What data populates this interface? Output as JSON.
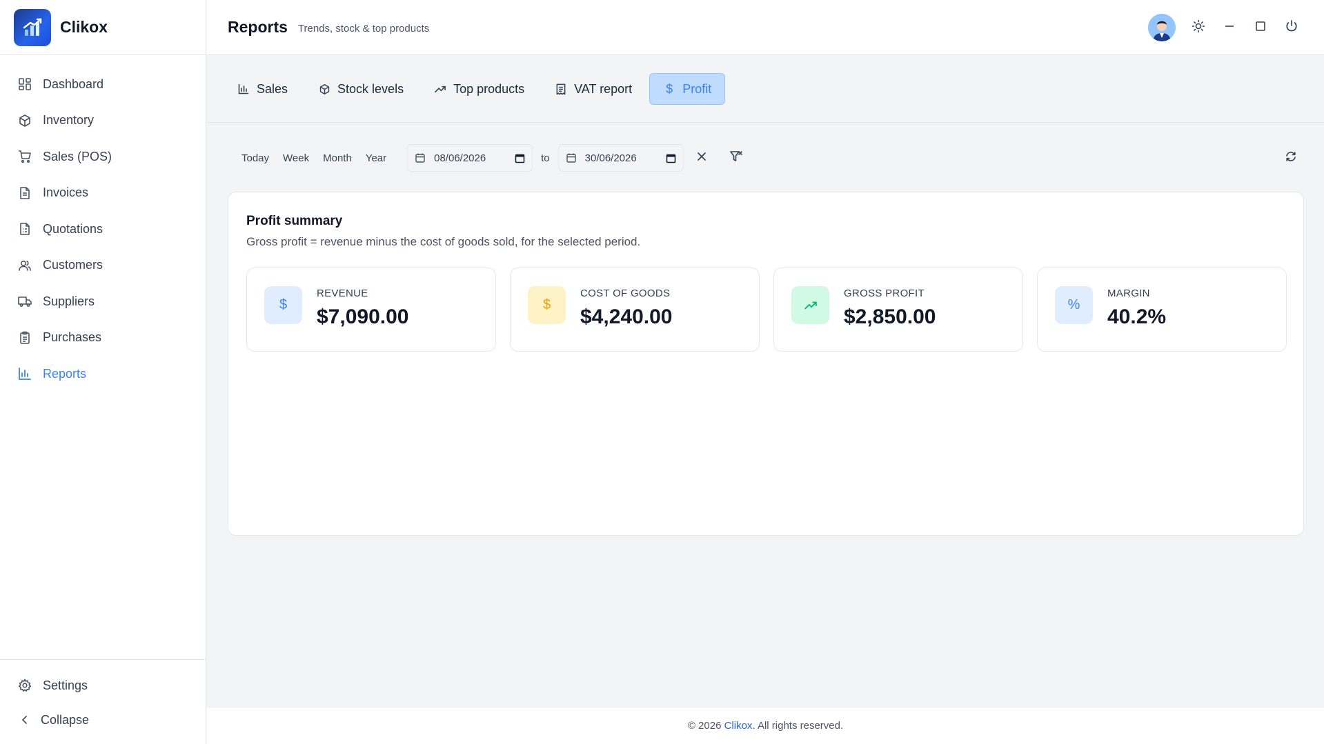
{
  "app": {
    "name": "Clikox"
  },
  "sidebar": {
    "items": [
      {
        "label": "Dashboard",
        "icon": "dashboard-icon"
      },
      {
        "label": "Inventory",
        "icon": "box-icon"
      },
      {
        "label": "Sales (POS)",
        "icon": "cart-icon"
      },
      {
        "label": "Invoices",
        "icon": "document-icon"
      },
      {
        "label": "Quotations",
        "icon": "quotation-icon"
      },
      {
        "label": "Customers",
        "icon": "users-icon"
      },
      {
        "label": "Suppliers",
        "icon": "truck-icon"
      },
      {
        "label": "Purchases",
        "icon": "clipboard-icon"
      },
      {
        "label": "Reports",
        "icon": "bar-chart-icon",
        "active": true
      }
    ],
    "settings_label": "Settings",
    "collapse_label": "Collapse"
  },
  "header": {
    "title": "Reports",
    "subtitle": "Trends, stock & top products"
  },
  "tabs": [
    {
      "label": "Sales",
      "icon": "bar-chart-icon"
    },
    {
      "label": "Stock levels",
      "icon": "box-icon"
    },
    {
      "label": "Top products",
      "icon": "trend-up-icon"
    },
    {
      "label": "VAT report",
      "icon": "receipt-icon"
    },
    {
      "label": "Profit",
      "icon": "dollar-icon",
      "active": true
    }
  ],
  "filters": {
    "quick": [
      "Today",
      "Week",
      "Month",
      "Year"
    ],
    "from_date": "08/06/2026",
    "to_label": "to",
    "to_date": "30/06/2026"
  },
  "summary": {
    "title": "Profit summary",
    "description": "Gross profit = revenue minus the cost of goods sold, for the selected period.",
    "stats": [
      {
        "label": "REVENUE",
        "value": "$7,090.00",
        "icon": "dollar-icon",
        "glyph": "$",
        "bg": "#e0edff",
        "fg": "#3b82f6"
      },
      {
        "label": "COST OF GOODS",
        "value": "$4,240.00",
        "icon": "dollar-icon",
        "glyph": "$",
        "bg": "#fef3c7",
        "fg": "#f59e0b"
      },
      {
        "label": "GROSS PROFIT",
        "value": "$2,850.00",
        "icon": "trend-up-icon",
        "glyph": "",
        "bg": "#d1fae5",
        "fg": "#10b981"
      },
      {
        "label": "MARGIN",
        "value": "40.2%",
        "icon": "percent-icon",
        "glyph": "%",
        "bg": "#e0edff",
        "fg": "#3b82f6"
      }
    ]
  },
  "footer": {
    "prefix": "© 2026 ",
    "brand": "Clikox",
    "suffix": ". All rights reserved."
  },
  "colors": {
    "accent": "#3b82f6",
    "active_tab_bg": "#bfdbfe"
  }
}
